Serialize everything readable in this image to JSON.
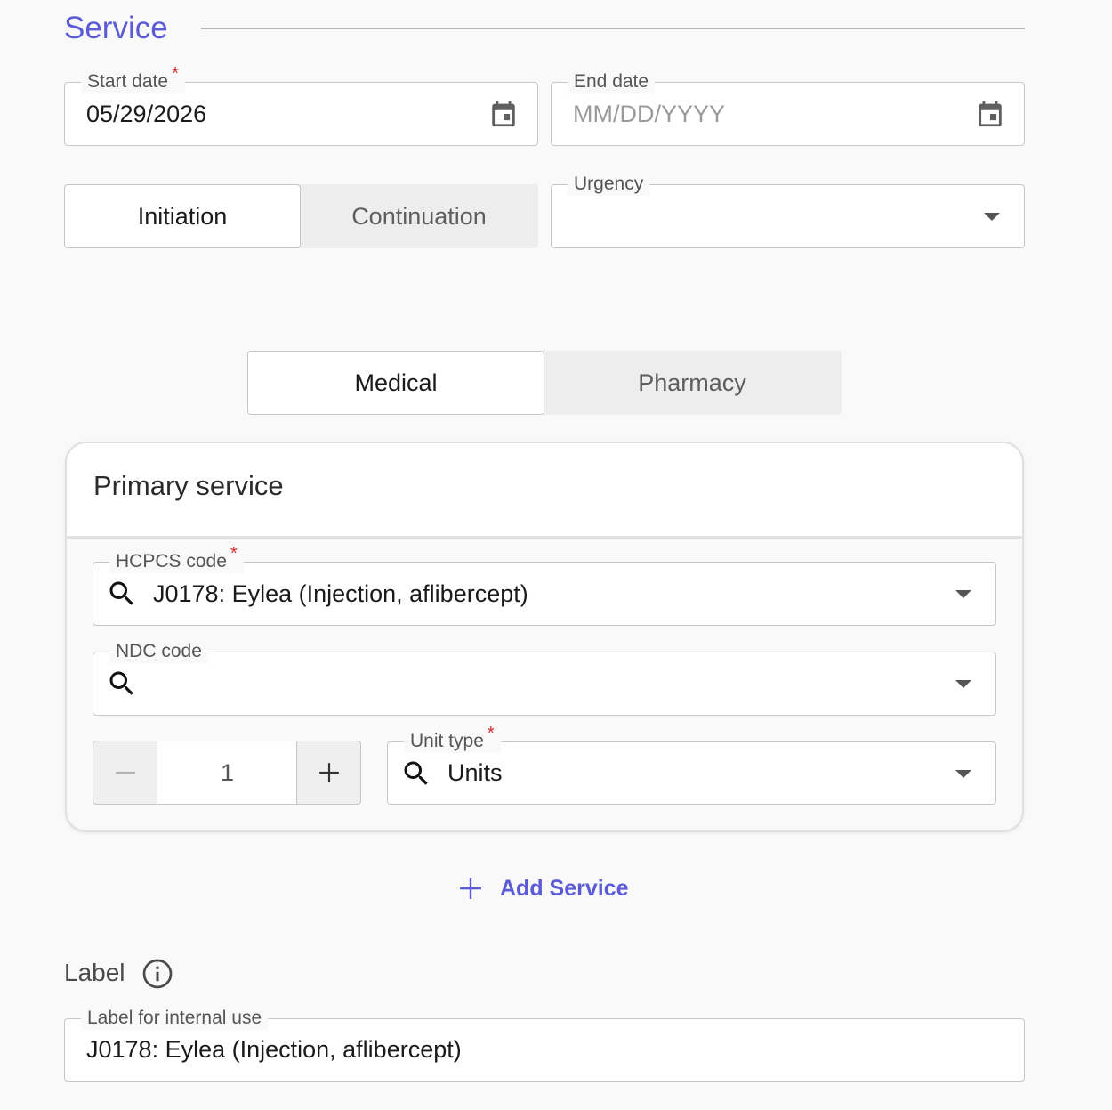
{
  "section": {
    "title": "Service"
  },
  "dates": {
    "start": {
      "label": "Start date",
      "value": "05/29/2026",
      "required": "*"
    },
    "end": {
      "label": "End date",
      "placeholder": "MM/DD/YYYY"
    }
  },
  "phase_toggle": {
    "options": [
      "Initiation",
      "Continuation"
    ],
    "selected": "Initiation"
  },
  "urgency": {
    "label": "Urgency",
    "value": ""
  },
  "benefit_toggle": {
    "options": [
      "Medical",
      "Pharmacy"
    ],
    "selected": "Medical"
  },
  "primary_service": {
    "title": "Primary service",
    "hcpcs": {
      "label": "HCPCS code",
      "required": "*",
      "value": "J0178: Eylea (Injection, aflibercept)"
    },
    "ndc": {
      "label": "NDC code",
      "value": ""
    },
    "quantity": {
      "value": "1",
      "decrement": "−",
      "increment": "+"
    },
    "unit_type": {
      "label": "Unit type",
      "required": "*",
      "value": "Units"
    }
  },
  "add_service": {
    "label": "Add Service"
  },
  "label_section": {
    "heading": "Label",
    "field_label": "Label for internal use",
    "value": "J0178: Eylea (Injection, aflibercept)"
  },
  "colors": {
    "accent": "#5b5bd6",
    "required": "#d32f2f"
  },
  "icons": [
    "calendar-icon",
    "chevron-down-icon",
    "search-icon",
    "plus-icon",
    "minus-icon",
    "info-icon"
  ]
}
